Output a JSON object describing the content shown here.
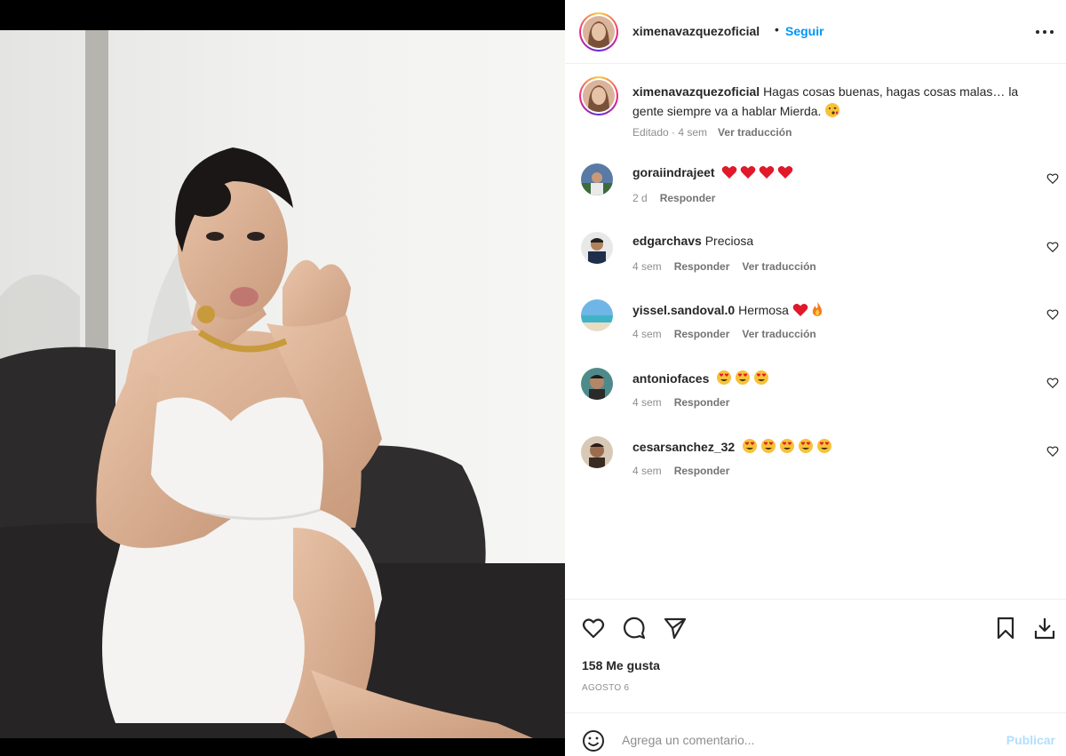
{
  "post": {
    "username": "ximenavazquezoficial",
    "follow_label": "Seguir",
    "dot": "•",
    "caption_text": "Hagas cosas buenas, hagas cosas malas… la gente siempre va a hablar Mierda.",
    "caption_emoji": "kissing-face-icon",
    "caption_meta": "Editado · 4 sem",
    "translate_label": "Ver traducción"
  },
  "comments": [
    {
      "username": "goraiindrajeet",
      "text": "",
      "emojis": [
        "red-heart-icon",
        "red-heart-icon",
        "red-heart-icon",
        "red-heart-icon"
      ],
      "time": "2 d",
      "reply": "Responder",
      "translate": ""
    },
    {
      "username": "edgarchavs",
      "text": "Preciosa",
      "emojis": [],
      "time": "4 sem",
      "reply": "Responder",
      "translate": "Ver traducción"
    },
    {
      "username": "yissel.sandoval.0",
      "text": "Hermosa",
      "emojis": [
        "red-heart-icon",
        "fire-icon"
      ],
      "time": "4 sem",
      "reply": "Responder",
      "translate": "Ver traducción"
    },
    {
      "username": "antoniofaces",
      "text": "",
      "emojis": [
        "heart-eyes-icon",
        "heart-eyes-icon",
        "heart-eyes-icon"
      ],
      "time": "4 sem",
      "reply": "Responder",
      "translate": ""
    },
    {
      "username": "cesarsanchez_32",
      "text": "",
      "emojis": [
        "heart-eyes-icon",
        "heart-eyes-icon",
        "heart-eyes-icon",
        "heart-eyes-icon",
        "heart-eyes-icon"
      ],
      "time": "4 sem",
      "reply": "Responder",
      "translate": ""
    }
  ],
  "actions": {
    "likes": "158 Me gusta",
    "date": "AGOSTO 6"
  },
  "add_comment": {
    "placeholder": "Agrega un comentario...",
    "publish": "Publicar"
  },
  "colors": {
    "accent": "#0095f6",
    "publish_disabled": "#b2dffc",
    "muted": "#8e8e8e"
  }
}
